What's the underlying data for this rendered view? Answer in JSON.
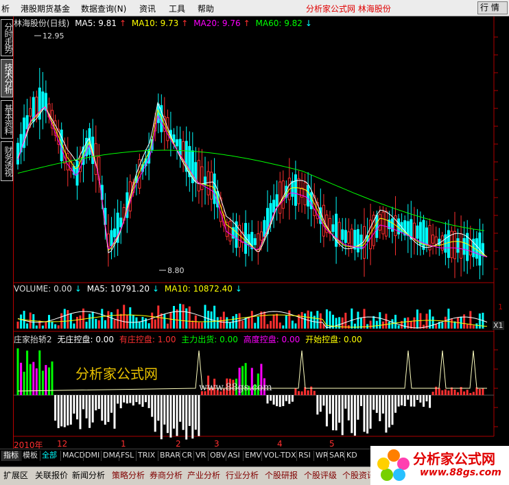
{
  "menubar": {
    "items": [
      "析",
      "港股期货基金",
      "数据查询(N)",
      "资讯",
      "工具",
      "帮助"
    ],
    "brand": "分析家公式网  林海股份",
    "window_button": "行 情"
  },
  "sidebar": {
    "tabs": [
      "分时走势",
      "技术分析",
      "基本资料",
      "财务透视"
    ],
    "active": 1
  },
  "main_chart": {
    "stock": "林海股份(日线)",
    "ma5_label": "MA5: 9.81",
    "ma10_label": "MA10: 9.73",
    "ma20_label": "MA20: 9.76",
    "ma60_label": "MA60: 9.82",
    "high_label": "12.95",
    "low_label": "8.80",
    "colors": {
      "ma5": "#ffffff",
      "ma10": "#ffff00",
      "ma20": "#ff00ff",
      "ma60": "#00ff00",
      "up": "#ff3030",
      "down": "#00ffff"
    }
  },
  "volume_chart": {
    "label": "VOLUME: 0.00",
    "ma5_label": "MA5: 10791.20",
    "ma10_label": "MA10: 10872.40",
    "axis_tick": "1",
    "unit": "X1"
  },
  "indicator_chart": {
    "name": "庄家抬轿2",
    "items": [
      {
        "label": "无庄控盘: 0.00",
        "color": "#ffffff"
      },
      {
        "label": "有庄控盘: 1.00",
        "color": "#ff3030"
      },
      {
        "label": "主力出货: 0.00",
        "color": "#00ff00"
      },
      {
        "label": "高度控盘: 0.00",
        "color": "#ff00ff"
      },
      {
        "label": "开始控盘: 0.00",
        "color": "#ffff00"
      }
    ]
  },
  "date_axis": {
    "year": "2010年",
    "ticks": [
      "12",
      "1",
      "2",
      "3",
      "4",
      "5"
    ]
  },
  "bottom_tabs": [
    "指标",
    "模板",
    "全部",
    "MACD",
    "DMI",
    "DMA",
    "FSL",
    "TRIX",
    "BRAR",
    "CR",
    "VR",
    "OBV",
    "ASI",
    "EMV",
    "VOL-TDX",
    "RSI",
    "WR",
    "SAR",
    "KD"
  ],
  "status_buttons": [
    "扩展区",
    "关联报价",
    "新闻分析",
    "策略分析",
    "券商分析",
    "产业分析",
    "行业分析",
    "个股研报",
    "个股评级",
    "个股资讯"
  ],
  "logo": {
    "title": "分析家公式网",
    "url": "www.88gs.com"
  },
  "watermark": {
    "main": "分析家公式网",
    "url": "www.88gs.com"
  }
}
